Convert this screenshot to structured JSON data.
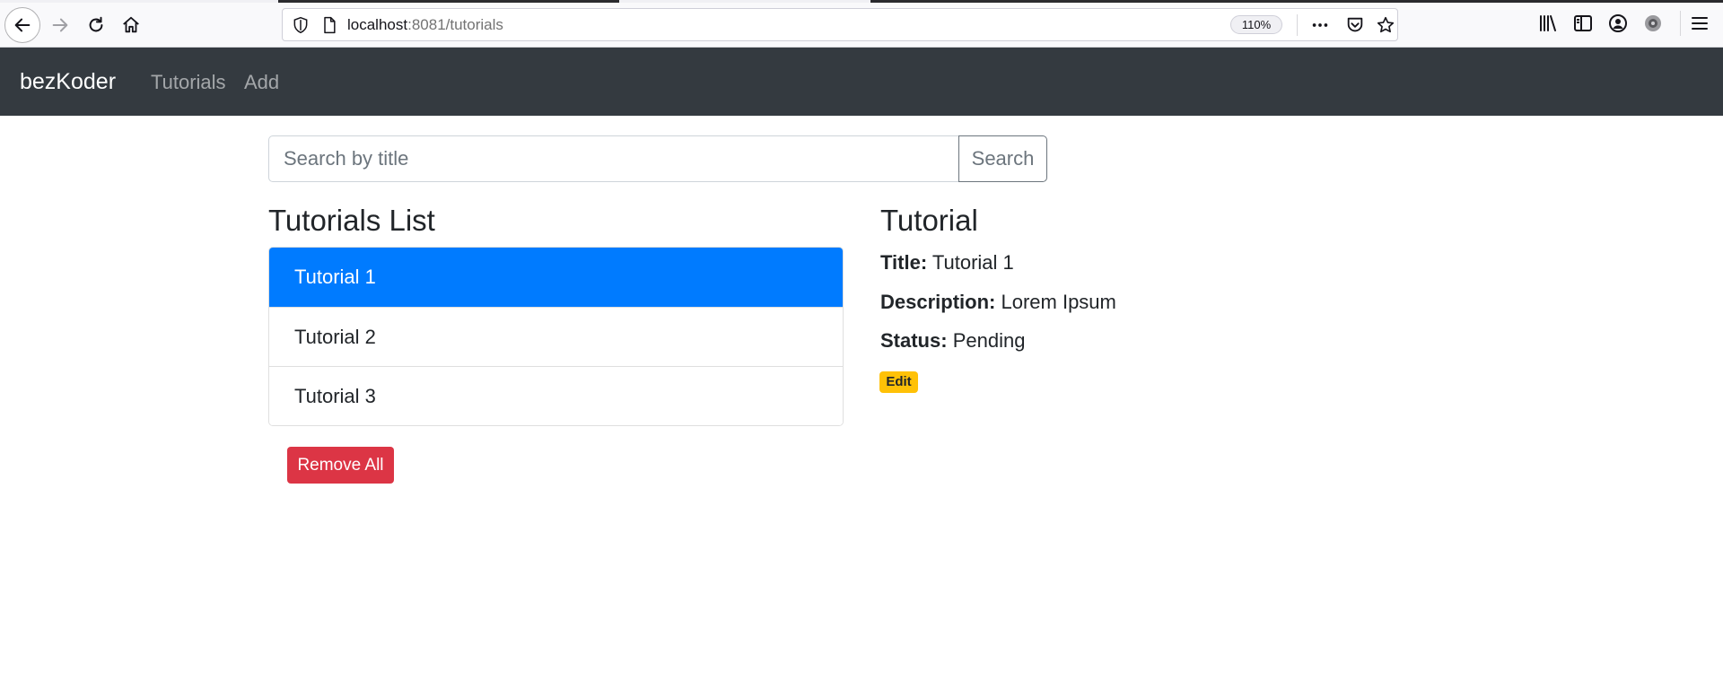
{
  "browser": {
    "url_host": "localhost",
    "url_path": ":8081/tutorials",
    "zoom": "110%"
  },
  "navbar": {
    "brand": "bezKoder",
    "links": [
      {
        "label": "Tutorials"
      },
      {
        "label": "Add"
      }
    ]
  },
  "search": {
    "placeholder": "Search by title",
    "button_label": "Search"
  },
  "tutorials_list": {
    "title": "Tutorials List",
    "items": [
      {
        "label": "Tutorial 1",
        "active": true
      },
      {
        "label": "Tutorial 2",
        "active": false
      },
      {
        "label": "Tutorial 3",
        "active": false
      }
    ],
    "remove_all_label": "Remove All"
  },
  "detail": {
    "heading": "Tutorial",
    "title_label": "Title:",
    "title_value": "Tutorial 1",
    "description_label": "Description:",
    "description_value": "Lorem Ipsum",
    "status_label": "Status:",
    "status_value": "Pending",
    "edit_label": "Edit"
  },
  "colors": {
    "navbar_bg": "#343a40",
    "active_item": "#007bff",
    "danger": "#dc3545",
    "warning": "#ffc107"
  },
  "icons": [
    "back-icon",
    "forward-icon",
    "reload-icon",
    "home-icon",
    "shield-icon",
    "page-icon",
    "more-icon",
    "pocket-icon",
    "star-icon",
    "library-icon",
    "sidebar-icon",
    "account-icon",
    "extension-icon",
    "menu-icon"
  ]
}
